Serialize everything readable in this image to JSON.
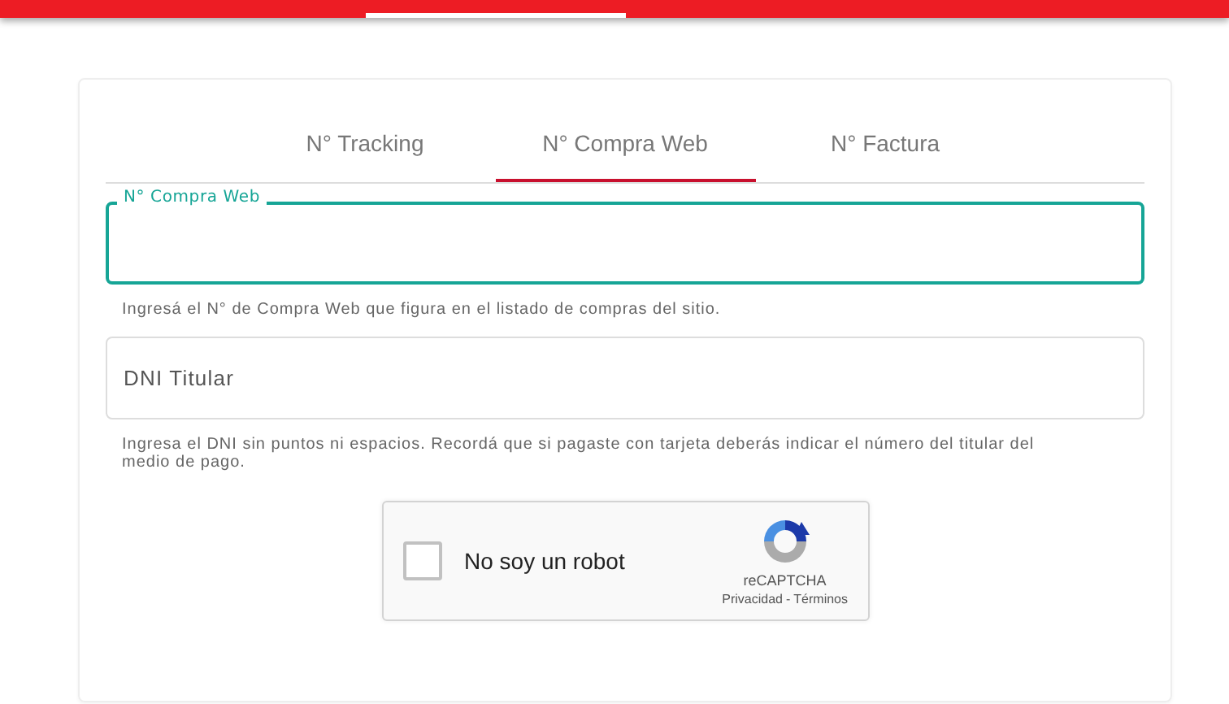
{
  "tabs": [
    {
      "label": "N° Tracking",
      "selected": false
    },
    {
      "label": "N° Compra Web",
      "selected": true
    },
    {
      "label": "N° Factura",
      "selected": false
    }
  ],
  "fields": [
    {
      "label": "N° Compra Web",
      "focused": true,
      "hint": "Ingresá el N° de Compra Web que figura en el listado de compras del sitio."
    },
    {
      "placeholder": "DNI Titular",
      "focused": false,
      "hint": "Ingresa el DNI sin puntos ni espacios. Recordá que si pagaste con tarjeta deberás indicar el número del titular del medio de pago."
    }
  ],
  "captcha": {
    "checked": false,
    "text": "No soy un robot",
    "brand": "reCAPTCHA",
    "links": [
      "Privacidad",
      "Términos"
    ],
    "separator": "-"
  }
}
